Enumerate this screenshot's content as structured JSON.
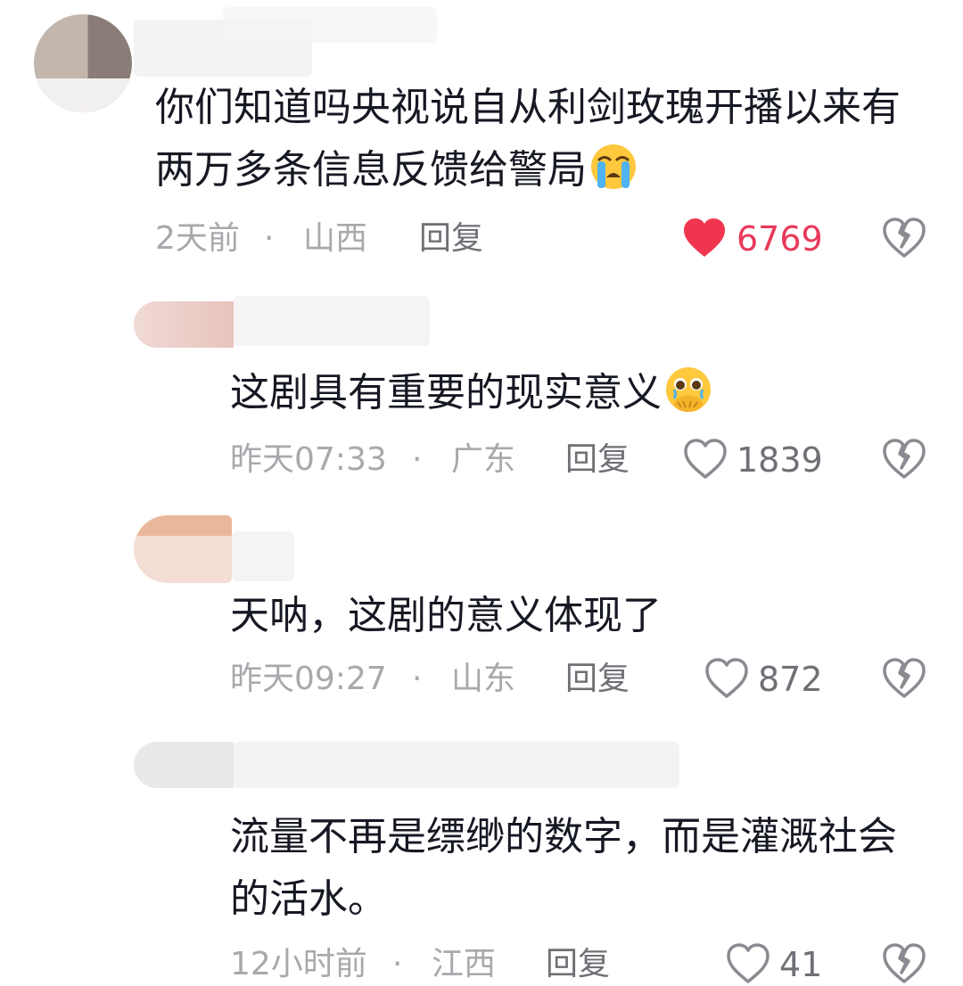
{
  "comments": [
    {
      "text_lines": [
        "你们知道吗央视说自从利剑玫瑰开播以来有",
        "两万多条信息反馈给警局"
      ],
      "emoji": "loudly-crying-face",
      "time": "2天前",
      "separator": "·",
      "location": "山西",
      "reply_label": "回复",
      "likes": "6769",
      "liked": true
    },
    {
      "text_lines": [
        "这剧具有重要的现实意义"
      ],
      "emoji": "face-holding-back-tears",
      "time": "昨天07:33",
      "separator": "·",
      "location": "广东",
      "reply_label": "回复",
      "likes": "1839",
      "liked": false
    },
    {
      "text_lines": [
        "天呐，这剧的意义体现了"
      ],
      "time": "昨天09:27",
      "separator": "·",
      "location": "山东",
      "reply_label": "回复",
      "likes": "872",
      "liked": false
    },
    {
      "text_lines": [
        "流量不再是缥缈的数字，而是灌溉社会",
        "的活水。"
      ],
      "time": "12小时前",
      "separator": "·",
      "location": "江西",
      "reply_label": "回复",
      "likes": "41",
      "liked": false
    }
  ],
  "colors": {
    "liked_heart": "#f0364f",
    "meta_text": "#a8a9ad",
    "icon_gray": "#8a8b91"
  },
  "icons": {
    "like": "heart-icon",
    "dislike": "broken-heart-icon"
  }
}
